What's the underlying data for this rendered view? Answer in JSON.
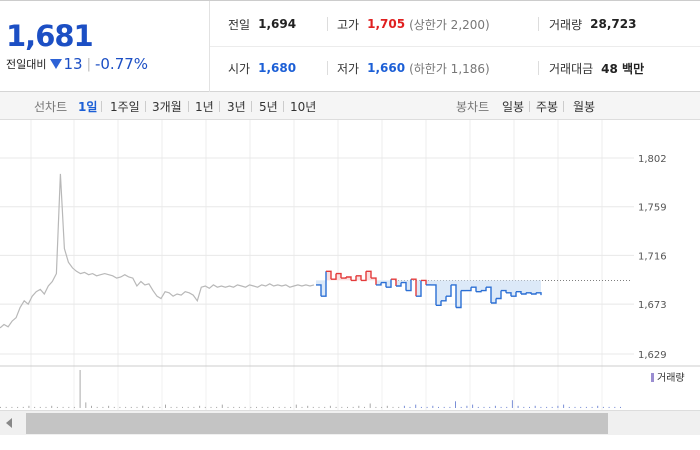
{
  "quote": {
    "price": "1,681",
    "change_label": "전일대비",
    "change_value": "13",
    "change_sep": "|",
    "change_pct": "-0.77%",
    "prev_close_label": "전일",
    "prev_close": "1,694",
    "high_label": "고가",
    "high": "1,705",
    "upper_limit": "(상한가 2,200)",
    "volume_label": "거래량",
    "volume": "28,723",
    "open_label": "시가",
    "open": "1,680",
    "low_label": "저가",
    "low": "1,660",
    "lower_limit": "(하한가 1,186)",
    "amount_label": "거래대금",
    "amount": "48 백만"
  },
  "tabs": {
    "line_label": "선차트",
    "line_items": [
      "1일",
      "1주일",
      "3개월",
      "1년",
      "3년",
      "5년",
      "10년"
    ],
    "active": "1일",
    "candle_label": "봉차트",
    "candle_items": [
      "일봉",
      "주봉",
      "월봉"
    ]
  },
  "chart_data": {
    "type": "line",
    "ylim": [
      1629,
      1802
    ],
    "yticks": [
      "1,802",
      "1,759",
      "1,716",
      "1,673",
      "1,629"
    ],
    "ytick_values": [
      1802,
      1759,
      1716,
      1673,
      1629
    ],
    "reference_value": 1694,
    "prev_day_series": [
      1652,
      1655,
      1653,
      1658,
      1661,
      1670,
      1676,
      1673,
      1680,
      1684,
      1686,
      1682,
      1689,
      1693,
      1700,
      1788,
      1722,
      1710,
      1705,
      1702,
      1700,
      1701,
      1699,
      1700,
      1698,
      1699,
      1700,
      1699,
      1698,
      1696,
      1697,
      1699,
      1697,
      1696,
      1689,
      1693,
      1690,
      1691,
      1685,
      1680,
      1678,
      1684,
      1683,
      1680,
      1682,
      1681,
      1684,
      1683,
      1681,
      1676,
      1688,
      1689,
      1687,
      1690,
      1688,
      1689,
      1688,
      1689,
      1688,
      1690,
      1689,
      1688,
      1690,
      1689,
      1688,
      1690,
      1689,
      1691,
      1689,
      1690,
      1689,
      1690,
      1688,
      1689,
      1690,
      1689,
      1690,
      1689,
      1690
    ],
    "today_series": [
      1690,
      1680,
      1702,
      1695,
      1700,
      1696,
      1697,
      1694,
      1698,
      1694,
      1702,
      1696,
      1690,
      1692,
      1688,
      1695,
      1689,
      1692,
      1685,
      1695,
      1680,
      1694,
      1690,
      1690,
      1672,
      1676,
      1680,
      1690,
      1670,
      1685,
      1685,
      1688,
      1684,
      1685,
      1688,
      1674,
      1678,
      1685,
      1683,
      1680,
      1684,
      1682,
      1683,
      1682,
      1683,
      1681
    ],
    "volume_label": "거래량",
    "volume_series": [
      1,
      1,
      1,
      1,
      1,
      2,
      1,
      1,
      1,
      2,
      1,
      1,
      1,
      1,
      34,
      5,
      2,
      1,
      1,
      2,
      1,
      1,
      1,
      1,
      1,
      2,
      1,
      1,
      1,
      3,
      1,
      1,
      1,
      1,
      1,
      2,
      1,
      1,
      1,
      3,
      1,
      1,
      1,
      1,
      1,
      1,
      1,
      1,
      1,
      1,
      1,
      1,
      3,
      1,
      2,
      1,
      1,
      1,
      2,
      1,
      1,
      1,
      1,
      2,
      1,
      4,
      1,
      1,
      2,
      1,
      1,
      2,
      1,
      3,
      1,
      1,
      2,
      1,
      1,
      1,
      6,
      1,
      2,
      3,
      1,
      1,
      1,
      2,
      1,
      1,
      7,
      2,
      1,
      1,
      2,
      1,
      1,
      1,
      2,
      3,
      1,
      1,
      1,
      1,
      1,
      2,
      1,
      1,
      1,
      1
    ]
  }
}
